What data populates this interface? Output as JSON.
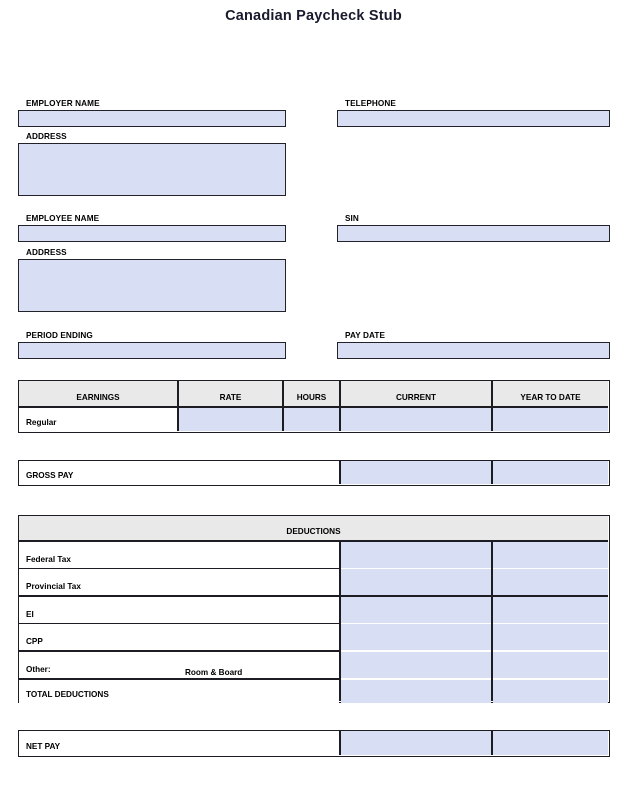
{
  "document": {
    "title": "Canadian Paycheck Stub"
  },
  "employer_section": {
    "name_label": "EMPLOYER NAME",
    "name_value": "",
    "address_label": "ADDRESS",
    "address_value": "",
    "telephone_label": "TELEPHONE",
    "telephone_value": ""
  },
  "employee_section": {
    "name_label": "EMPLOYEE NAME",
    "name_value": "",
    "address_label": "ADDRESS",
    "address_value": "",
    "sin_label": "SIN",
    "sin_value": ""
  },
  "period_section": {
    "period_ending_label": "PERIOD ENDING",
    "period_ending_value": "",
    "pay_date_label": "PAY DATE",
    "pay_date_value": ""
  },
  "earnings_table": {
    "headers": [
      "EARNINGS",
      "RATE",
      "HOURS",
      "CURRENT",
      "YEAR TO DATE"
    ],
    "rows": [
      {
        "label": "Regular",
        "rate": "",
        "hours": "",
        "current": "",
        "year_to_date": ""
      }
    ]
  },
  "gross_pay": {
    "label": "GROSS PAY",
    "current": "",
    "year_to_date": ""
  },
  "deductions_table": {
    "header": "DEDUCTIONS",
    "rows": [
      {
        "label": "Federal Tax",
        "extra": "",
        "current": "",
        "year_to_date": ""
      },
      {
        "label": "Provincial Tax",
        "extra": "",
        "current": "",
        "year_to_date": ""
      },
      {
        "label": "EI",
        "extra": "",
        "current": "",
        "year_to_date": ""
      },
      {
        "label": "CPP",
        "extra": "",
        "current": "",
        "year_to_date": ""
      },
      {
        "label": "Other:",
        "extra": "Room & Board",
        "current": "",
        "year_to_date": ""
      },
      {
        "label": "TOTAL DEDUCTIONS",
        "extra": "",
        "current": "",
        "year_to_date": ""
      }
    ]
  },
  "net_pay": {
    "label": "NET PAY",
    "current": "",
    "year_to_date": ""
  },
  "colors": {
    "field_fill": "#d8def4",
    "header_gray": "#e9e9e9",
    "border": "#1c1c22",
    "title": "#1a1a2e"
  }
}
